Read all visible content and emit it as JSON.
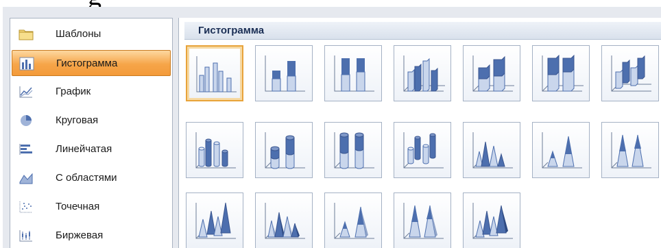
{
  "sidebar": {
    "items": [
      {
        "label": "Шаблоны",
        "icon": "folder-icon",
        "selected": false
      },
      {
        "label": "Гистограмма",
        "icon": "column-chart-icon",
        "selected": true
      },
      {
        "label": "График",
        "icon": "line-chart-icon",
        "selected": false
      },
      {
        "label": "Круговая",
        "icon": "pie-chart-icon",
        "selected": false
      },
      {
        "label": "Линейчатая",
        "icon": "bar-chart-icon",
        "selected": false
      },
      {
        "label": "С областями",
        "icon": "area-chart-icon",
        "selected": false
      },
      {
        "label": "Точечная",
        "icon": "scatter-chart-icon",
        "selected": false
      },
      {
        "label": "Биржевая",
        "icon": "stock-chart-icon",
        "selected": false
      }
    ]
  },
  "main": {
    "group_title": "Гистограмма",
    "tiles": [
      {
        "icon": "clustered-column-icon",
        "selected": true
      },
      {
        "icon": "stacked-column-icon",
        "selected": false
      },
      {
        "icon": "100-stacked-column-icon",
        "selected": false
      },
      {
        "icon": "3d-clustered-column-icon",
        "selected": false
      },
      {
        "icon": "3d-stacked-column-icon",
        "selected": false
      },
      {
        "icon": "3d-100-stacked-column-icon",
        "selected": false
      },
      {
        "icon": "3d-column-icon",
        "selected": false
      },
      {
        "icon": "clustered-cylinder-icon",
        "selected": false
      },
      {
        "icon": "stacked-cylinder-icon",
        "selected": false
      },
      {
        "icon": "100-stacked-cylinder-icon",
        "selected": false
      },
      {
        "icon": "3d-cylinder-icon",
        "selected": false
      },
      {
        "icon": "clustered-cone-icon",
        "selected": false
      },
      {
        "icon": "stacked-cone-icon",
        "selected": false
      },
      {
        "icon": "100-stacked-cone-icon",
        "selected": false
      },
      {
        "icon": "3d-cone-icon",
        "selected": false
      },
      {
        "icon": "clustered-pyramid-icon",
        "selected": false
      },
      {
        "icon": "stacked-pyramid-icon",
        "selected": false
      },
      {
        "icon": "100-stacked-pyramid-icon",
        "selected": false
      },
      {
        "icon": "3d-pyramid-icon",
        "selected": false
      }
    ]
  },
  "colors": {
    "selection_orange": "#f6a549",
    "tile_border": "#a4b1c4",
    "chart_blue": "#4d6fae",
    "chart_light": "#c9d6ec"
  }
}
